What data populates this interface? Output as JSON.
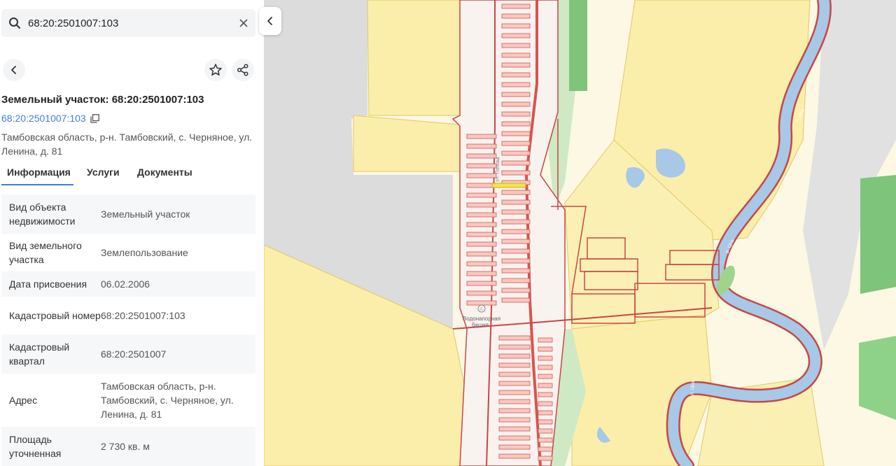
{
  "search": {
    "value": "68:20:2501007:103",
    "placeholder": ""
  },
  "parcel": {
    "title": "Земельный участок: 68:20:2501007:103",
    "cadastral_link": "68:20:2501007:103",
    "address": "Тамбовская область, р-н. Тамбовский, с. Черняное, ул. Ленина, д. 81"
  },
  "tabs": [
    {
      "label": "Информация"
    },
    {
      "label": "Услуги"
    },
    {
      "label": "Документы"
    }
  ],
  "info_rows": [
    {
      "key": "Вид объекта недвижимости",
      "value": "Земельный участок"
    },
    {
      "key": "Вид земельного участка",
      "value": "Землепользование"
    },
    {
      "key": "Дата присвоения",
      "value": "06.02.2006"
    },
    {
      "key": "Кадастровый номер",
      "value": "68:20:2501007:103"
    },
    {
      "key": "Кадастровый квартал",
      "value": "68:20:2501007"
    },
    {
      "key": "Адрес",
      "value": "Тамбовская область, р-н. Тамбовский, с. Черняное, ул. Ленина, д. 81"
    },
    {
      "key": "Площадь уточненная",
      "value": "2 730 кв. м"
    }
  ],
  "map": {
    "labels": {
      "tower_line1": "Водонапорная",
      "tower_line2": "башня",
      "street": "ул. Попова",
      "river1": "р. Цна",
      "river2": "р. Цна",
      "river3": "р. Цна"
    },
    "colors": {
      "background": "#fcf8e3",
      "field": "#fbeeaa",
      "gray_area": "#dcdcdc",
      "river": "#a7c8e6",
      "green": "#7ec47b",
      "parcel_border": "#d9534f",
      "parcel_fill": "#f7c9c0"
    }
  }
}
